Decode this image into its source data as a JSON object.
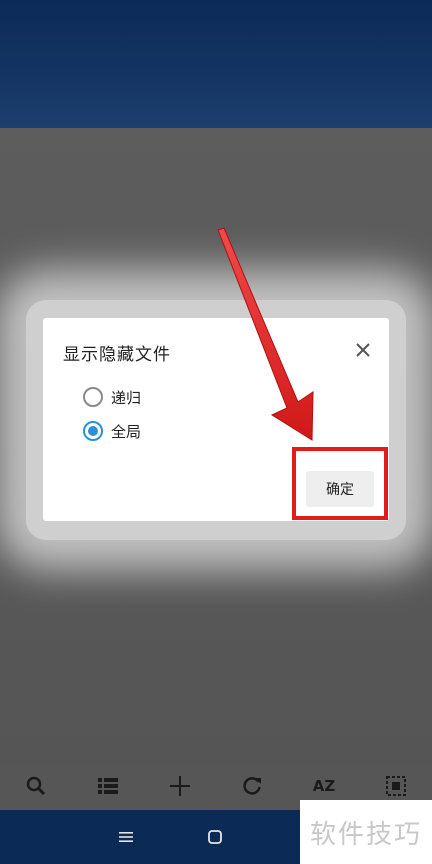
{
  "dialog": {
    "title": "显示隐藏文件",
    "options": [
      {
        "label": "递归",
        "checked": false
      },
      {
        "label": "全局",
        "checked": true
      }
    ],
    "confirm_label": "确定"
  },
  "toolbar": {
    "items": [
      "search-icon",
      "list-icon",
      "add-icon",
      "refresh-icon",
      "sort-az",
      "select-all-icon"
    ],
    "sort_label": "AZ"
  },
  "navbar": {
    "items": [
      "menu-icon",
      "home-icon"
    ]
  },
  "watermark": {
    "text": "软件技巧"
  },
  "colors": {
    "accent": "#2d8fd6",
    "annotation": "#e21c1c",
    "header": "#0c2a56"
  }
}
